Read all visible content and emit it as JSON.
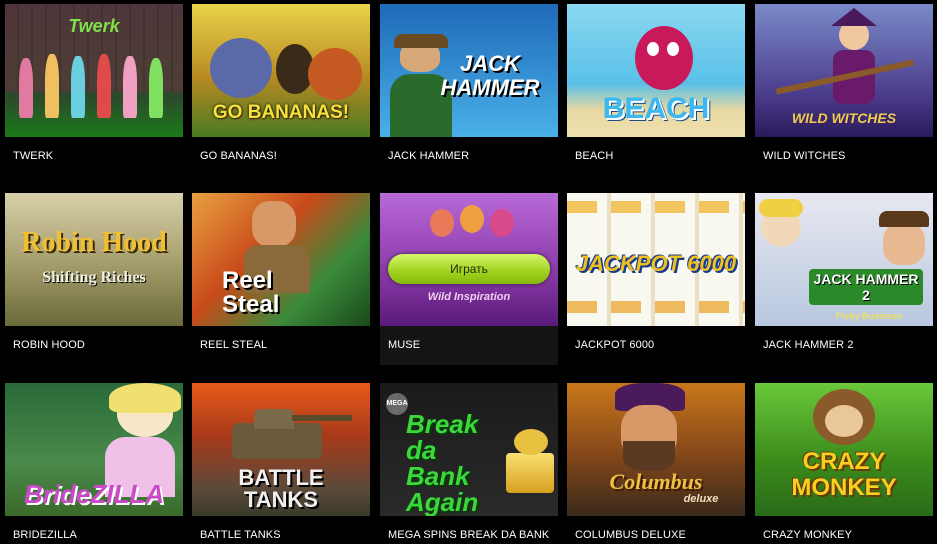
{
  "games": [
    {
      "title": "TWERK",
      "logo": "Twerk"
    },
    {
      "title": "GO BANANAS!",
      "logo": "GO BANANAS!"
    },
    {
      "title": "JACK HAMMER",
      "logo": "JACK HAMMER"
    },
    {
      "title": "BEACH",
      "logo": "BEACH"
    },
    {
      "title": "WILD WITCHES",
      "logo": "WILD WITCHES"
    },
    {
      "title": "ROBIN HOOD",
      "logo": "Robin Hood",
      "logo2": "Shifting Riches"
    },
    {
      "title": "REEL STEAL",
      "logo": "Reel Steal"
    },
    {
      "title": "MUSE",
      "logo": "Wild Inspiration",
      "play_label": "Играть"
    },
    {
      "title": "JACKPOT 6000",
      "logo": "JACKPOT 6000"
    },
    {
      "title": "JACK HAMMER 2",
      "logo": "JACK HAMMER 2",
      "logo2": "Fishy Business"
    },
    {
      "title": "BRIDEZILLA",
      "logo": "BrideZILLA"
    },
    {
      "title": "BATTLE TANKS",
      "logo": "BATTLE TANKS"
    },
    {
      "title": "MEGA SPINS BREAK DA BANK",
      "logo": "Break da Bank Again",
      "logo2": "MEGA"
    },
    {
      "title": "COLUMBUS DELUXE",
      "logo": "Columbus",
      "logo2": "deluxe"
    },
    {
      "title": "CRAZY MONKEY",
      "logo": "CRAZY MONKEY"
    }
  ]
}
